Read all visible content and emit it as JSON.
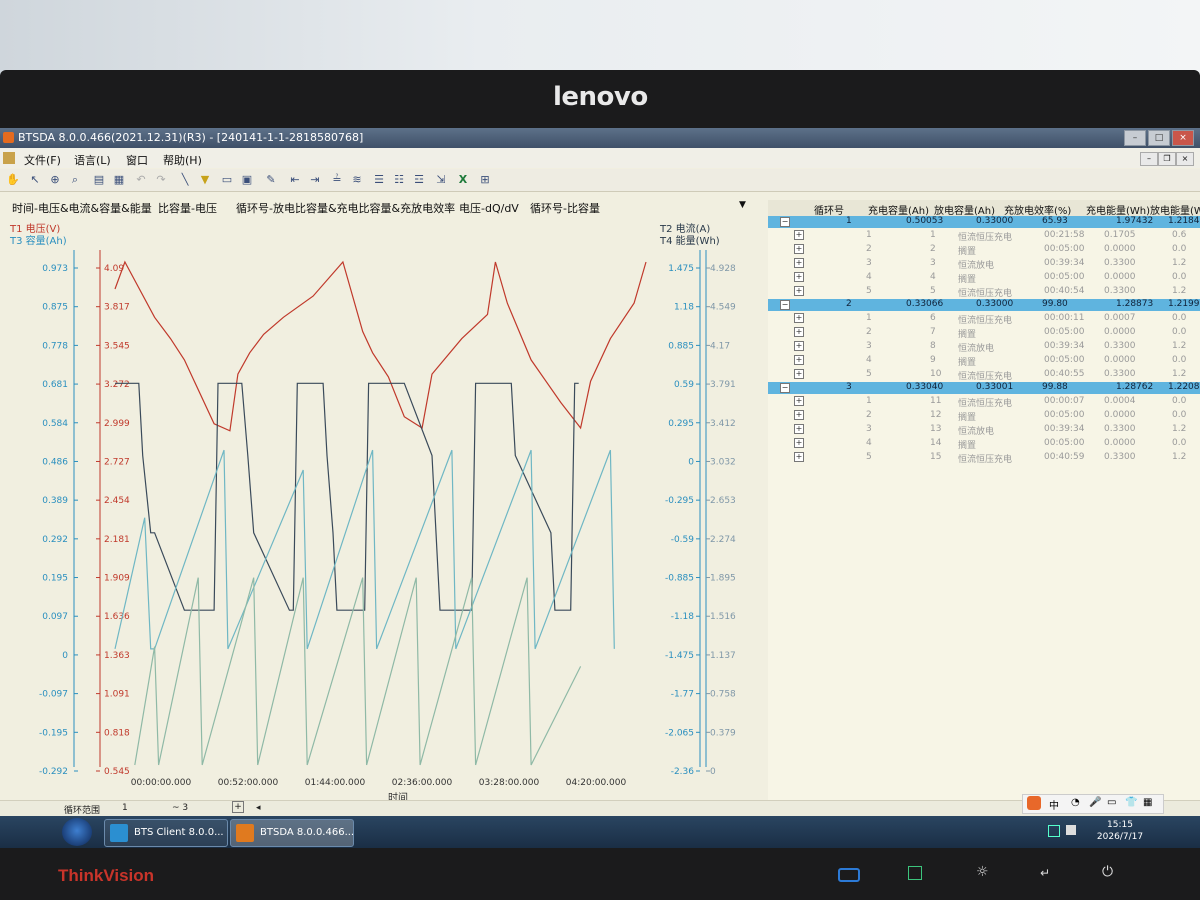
{
  "window": {
    "title": "BTSDA 8.0.0.466(2021.12.31)(R3) - [240141-1-1-2818580768]"
  },
  "monitor": {
    "brand_top": "lenovo",
    "brand_bottom": "ThinkVision"
  },
  "menu": {
    "file": "文件(F)",
    "language": "语言(L)",
    "window": "窗口",
    "help": "帮助(H)"
  },
  "tabs": [
    "时间-电压&电流&容量&能量",
    "比容量-电压",
    "循环号-放电比容量&充电比容量&充放电效率",
    "电压-dQ/dV",
    "循环号-比容量"
  ],
  "chart_data": {
    "type": "line",
    "legend_left": [
      "T1 电压(V)",
      "T3 容量(Ah)"
    ],
    "legend_right": [
      "T2 电流(A)",
      "T4 能量(Wh)"
    ],
    "xlabel": "时间",
    "x_ticks": [
      "00:00:00.000",
      "00:52:00.000",
      "01:44:00.000",
      "02:36:00.000",
      "03:28:00.000",
      "04:20:00.000"
    ],
    "x_range_min": [
      0,
      270
    ],
    "capacity_axis": {
      "label": "容量(Ah)",
      "ticks": [
        "0.973",
        "0.875",
        "0.778",
        "0.681",
        "0.584",
        "0.486",
        "0.389",
        "0.292",
        "0.195",
        "0.097",
        "0",
        "-0.097",
        "-0.195",
        "-0.292"
      ],
      "range": [
        -0.292,
        0.973
      ]
    },
    "voltage_axis": {
      "label": "电压(V)",
      "ticks": [
        "4.09",
        "3.817",
        "3.545",
        "3.272",
        "2.999",
        "2.727",
        "2.454",
        "2.181",
        "1.909",
        "1.636",
        "1.363",
        "1.091",
        "0.818",
        "0.545"
      ],
      "range": [
        0.545,
        4.09
      ]
    },
    "current_axis": {
      "label": "电流(A)",
      "ticks": [
        "1.475",
        "1.18",
        "0.885",
        "0.59",
        "0.295",
        "0",
        "-0.295",
        "-0.59",
        "-0.885",
        "-1.18",
        "-1.475",
        "-1.77",
        "-2.065",
        "-2.36"
      ],
      "range": [
        -2.36,
        1.475
      ]
    },
    "energy_axis": {
      "label": "能量(Wh)",
      "ticks": [
        "4.928",
        "4.549",
        "4.17",
        "3.791",
        "3.412",
        "3.032",
        "2.653",
        "2.274",
        "1.895",
        "1.516",
        "1.137",
        "0.758",
        "0.379",
        "0"
      ],
      "range": [
        0,
        5.1
      ]
    },
    "series": [
      {
        "name": "电压",
        "axis": "voltage",
        "color": "#c0392b",
        "x": [
          0,
          5,
          20,
          28,
          35,
          40,
          50,
          58,
          62,
          68,
          75,
          85,
          100,
          115,
          125,
          130,
          138,
          146,
          155,
          160,
          175,
          188,
          192,
          198,
          210,
          225,
          235,
          240,
          250,
          262,
          268
        ],
        "y": [
          3.9,
          4.09,
          3.7,
          3.55,
          3.4,
          3.25,
          2.95,
          2.9,
          3.3,
          3.45,
          3.58,
          3.7,
          3.85,
          4.09,
          3.6,
          3.45,
          3.28,
          3.0,
          2.92,
          3.3,
          3.55,
          3.72,
          4.09,
          3.8,
          3.4,
          3.1,
          2.92,
          3.25,
          3.55,
          3.8,
          4.09
        ]
      },
      {
        "name": "电流",
        "axis": "current",
        "color": "#3a4a5a",
        "x": [
          0,
          12,
          14,
          18,
          20,
          35,
          37,
          50,
          52,
          54,
          60,
          64,
          67,
          70,
          88,
          90,
          92,
          105,
          107,
          110,
          112,
          114,
          126,
          128,
          130,
          144,
          146,
          160,
          162,
          164,
          180,
          182,
          184,
          200,
          202,
          220,
          222,
          230,
          232,
          234
        ],
        "y": [
          0.55,
          0.55,
          0,
          -0.59,
          -0.59,
          -1.18,
          -1.18,
          -1.18,
          0.55,
          0.55,
          0.55,
          0.55,
          0,
          -0.59,
          -1.18,
          -1.18,
          0.55,
          0.55,
          0,
          -0.59,
          -1.18,
          -1.18,
          -1.18,
          0.55,
          0.55,
          0.55,
          0.55,
          0,
          -0.59,
          -1.18,
          -1.18,
          0.55,
          0.55,
          0.55,
          0,
          -0.59,
          -1.18,
          -1.18,
          0.55,
          0.55
        ]
      },
      {
        "name": "容量",
        "axis": "capacity",
        "color": "#6fb7c4",
        "x": [
          0,
          15,
          18,
          20,
          55,
          57,
          95,
          97,
          130,
          132,
          170,
          172,
          210,
          212,
          250,
          252
        ],
        "y": [
          0,
          0.33,
          0,
          0,
          0.5,
          0,
          0.45,
          0,
          0.5,
          0,
          0.5,
          0,
          0.5,
          0,
          0.5,
          0
        ]
      },
      {
        "name": "能量",
        "axis": "energy",
        "color": "#8fb9a6",
        "x": [
          10,
          20,
          22,
          42,
          44,
          70,
          72,
          95,
          97,
          125,
          127,
          152,
          154,
          180,
          182,
          208,
          210,
          235
        ],
        "y": [
          0,
          1.2,
          0,
          1.9,
          0,
          1.9,
          0,
          1.9,
          0,
          1.9,
          0,
          1.9,
          0,
          1.9,
          0,
          1.9,
          0,
          1.0
        ]
      }
    ]
  },
  "table": {
    "headers": [
      "循环号",
      "充电容量(Ah)",
      "放电容量(Ah)",
      "充放电效率(%)",
      "充电能量(Wh)",
      "放电能量(Wh)"
    ],
    "cycles": [
      {
        "no": "1",
        "charge_cap": "0.50053",
        "discharge_cap": "0.33000",
        "efficiency": "65.93",
        "charge_energy": "1.97432",
        "discharge_energy": "1.2184",
        "steps": [
          [
            "1",
            "1",
            "恒流恒压充电",
            "00:21:58",
            "0.1705",
            "0.6"
          ],
          [
            "2",
            "2",
            "搁置",
            "00:05:00",
            "0.0000",
            "0.0"
          ],
          [
            "3",
            "3",
            "恒流放电",
            "00:39:34",
            "0.3300",
            "1.2"
          ],
          [
            "4",
            "4",
            "搁置",
            "00:05:00",
            "0.0000",
            "0.0"
          ],
          [
            "5",
            "5",
            "恒流恒压充电",
            "00:40:54",
            "0.3300",
            "1.2"
          ]
        ]
      },
      {
        "no": "2",
        "charge_cap": "0.33066",
        "discharge_cap": "0.33000",
        "efficiency": "99.80",
        "charge_energy": "1.28873",
        "discharge_energy": "1.2199",
        "steps": [
          [
            "1",
            "6",
            "恒流恒压充电",
            "00:00:11",
            "0.0007",
            "0.0"
          ],
          [
            "2",
            "7",
            "搁置",
            "00:05:00",
            "0.0000",
            "0.0"
          ],
          [
            "3",
            "8",
            "恒流放电",
            "00:39:34",
            "0.3300",
            "1.2"
          ],
          [
            "4",
            "9",
            "搁置",
            "00:05:00",
            "0.0000",
            "0.0"
          ],
          [
            "5",
            "10",
            "恒流恒压充电",
            "00:40:55",
            "0.3300",
            "1.2"
          ]
        ]
      },
      {
        "no": "3",
        "charge_cap": "0.33040",
        "discharge_cap": "0.33001",
        "efficiency": "99.88",
        "charge_energy": "1.28762",
        "discharge_energy": "1.2208",
        "steps": [
          [
            "1",
            "11",
            "恒流恒压充电",
            "00:00:07",
            "0.0004",
            "0.0"
          ],
          [
            "2",
            "12",
            "搁置",
            "00:05:00",
            "0.0000",
            "0.0"
          ],
          [
            "3",
            "13",
            "恒流放电",
            "00:39:34",
            "0.3300",
            "1.2"
          ],
          [
            "4",
            "14",
            "搁置",
            "00:05:00",
            "0.0000",
            "0.0"
          ],
          [
            "5",
            "15",
            "恒流恒压充电",
            "00:40:59",
            "0.3300",
            "1.2"
          ]
        ]
      }
    ]
  },
  "status": {
    "cycle_range_label": "循环范围",
    "from": "1",
    "to": "~ 3"
  },
  "taskbar": {
    "tasks": [
      "BTS Client 8.0.0...",
      "BTSDA 8.0.0.466..."
    ],
    "time": "15:15",
    "date": "2026/7/17",
    "ime_label": "中"
  },
  "colors": {
    "voltage": "#c0392b",
    "capacity_axis": "#2a8fbf",
    "current": "#3a4a5a",
    "cycle_row": "#5fb4df"
  }
}
